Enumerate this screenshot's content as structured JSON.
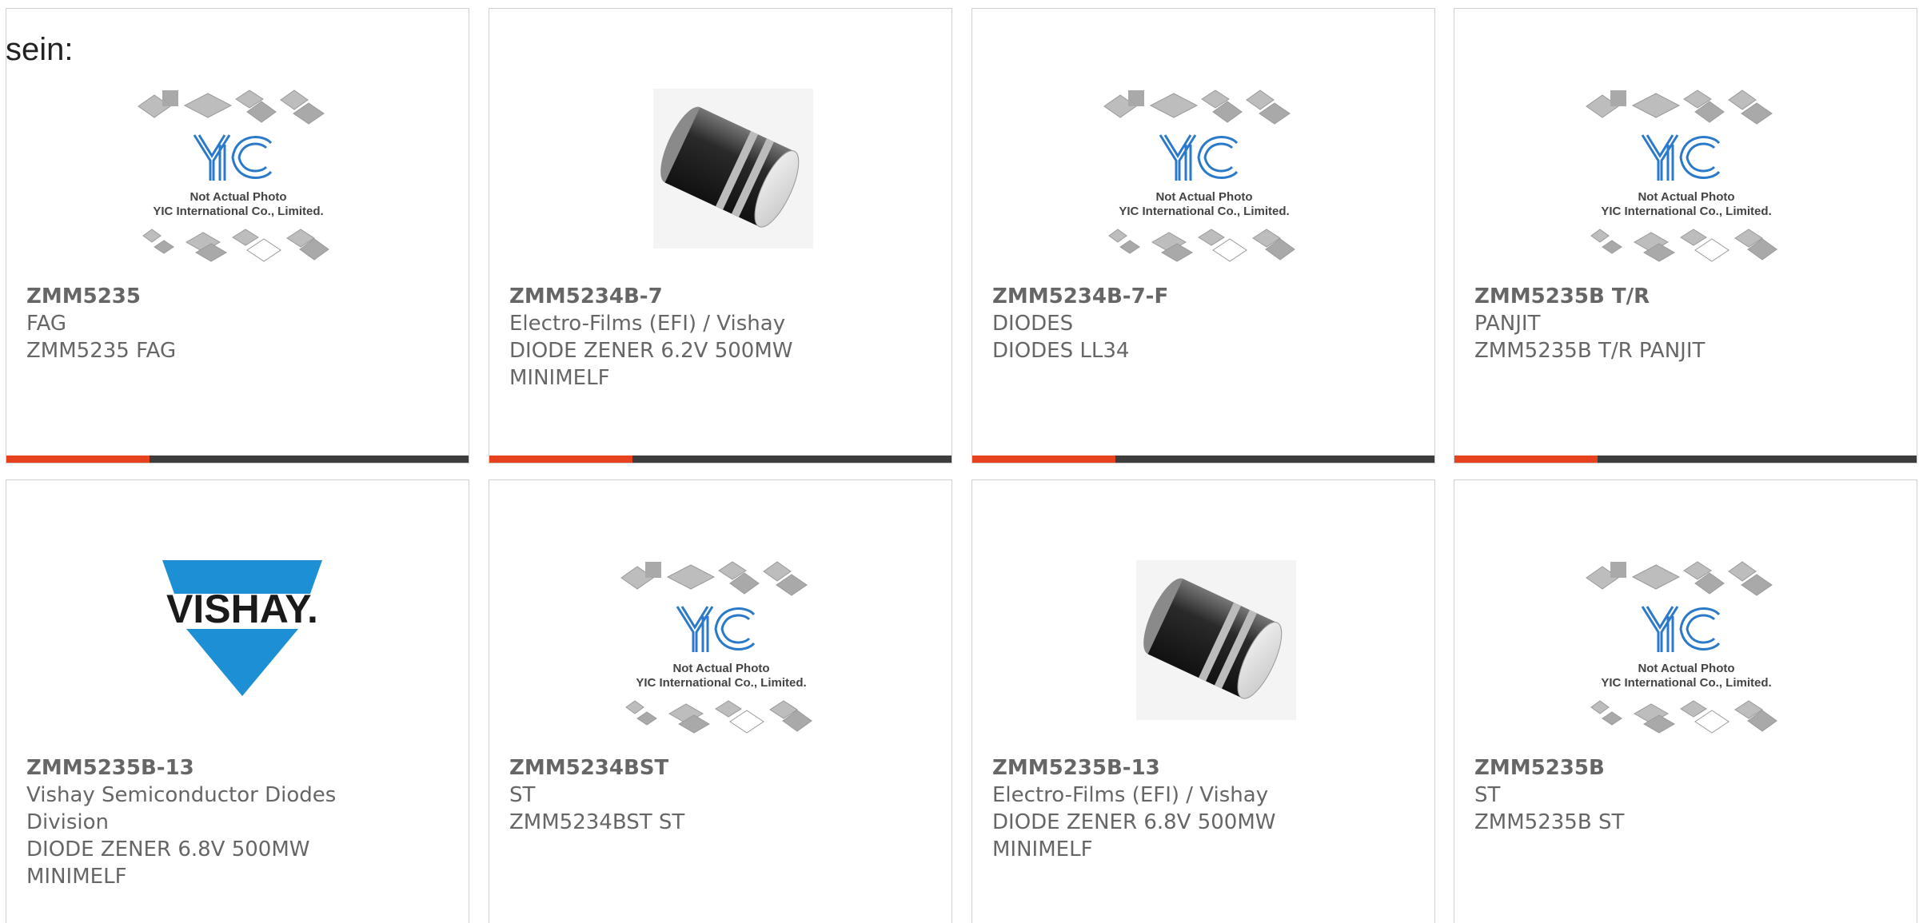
{
  "intro_text": "sein:",
  "progress_color": "#e8411d",
  "track_color": "#3d3d3d",
  "products": [
    {
      "image": "yic-placeholder",
      "part_number": "ZMM5235",
      "lines": [
        "FAG",
        "ZMM5235 FAG"
      ],
      "placeholder": {
        "caption1": "Not Actual Photo",
        "caption2": "YIC International Co., Limited.",
        "logo": "YIC"
      },
      "accent_progress": 0.31
    },
    {
      "image": "minimelf-diode",
      "part_number": "ZMM5234B-7",
      "lines": [
        "Electro-Films (EFI) / Vishay",
        "DIODE ZENER 6.2V 500MW",
        "MINIMELF"
      ],
      "accent_progress": 0.31
    },
    {
      "image": "yic-placeholder",
      "part_number": "ZMM5234B-7-F",
      "lines": [
        "DIODES",
        "DIODES LL34"
      ],
      "placeholder": {
        "caption1": "Not Actual Photo",
        "caption2": "YIC International Co., Limited.",
        "logo": "YIC"
      },
      "accent_progress": 0.31
    },
    {
      "image": "yic-placeholder",
      "part_number": "ZMM5235B T/R",
      "lines": [
        "PANJIT",
        "ZMM5235B T/R PANJIT"
      ],
      "placeholder": {
        "caption1": "Not Actual Photo",
        "caption2": "YIC International Co., Limited.",
        "logo": "YIC"
      },
      "accent_progress": 0.31
    },
    {
      "image": "vishay-logo",
      "part_number": "ZMM5235B-13",
      "lines": [
        "Vishay Semiconductor Diodes",
        "Division",
        "DIODE ZENER 6.8V 500MW",
        "MINIMELF"
      ],
      "vishay": {
        "wordmark": "VISHAY."
      }
    },
    {
      "image": "yic-placeholder",
      "part_number": "ZMM5234BST",
      "lines": [
        "ST",
        "ZMM5234BST ST"
      ],
      "placeholder": {
        "caption1": "Not Actual Photo",
        "caption2": "YIC International Co., Limited.",
        "logo": "YIC"
      }
    },
    {
      "image": "minimelf-diode",
      "part_number": "ZMM5235B-13",
      "lines": [
        "Electro-Films (EFI) / Vishay",
        "DIODE ZENER 6.8V 500MW",
        "MINIMELF"
      ]
    },
    {
      "image": "yic-placeholder",
      "part_number": "ZMM5235B",
      "lines": [
        "ST",
        "ZMM5235B ST"
      ],
      "placeholder": {
        "caption1": "Not Actual Photo",
        "caption2": "YIC International Co., Limited.",
        "logo": "YIC"
      }
    }
  ]
}
